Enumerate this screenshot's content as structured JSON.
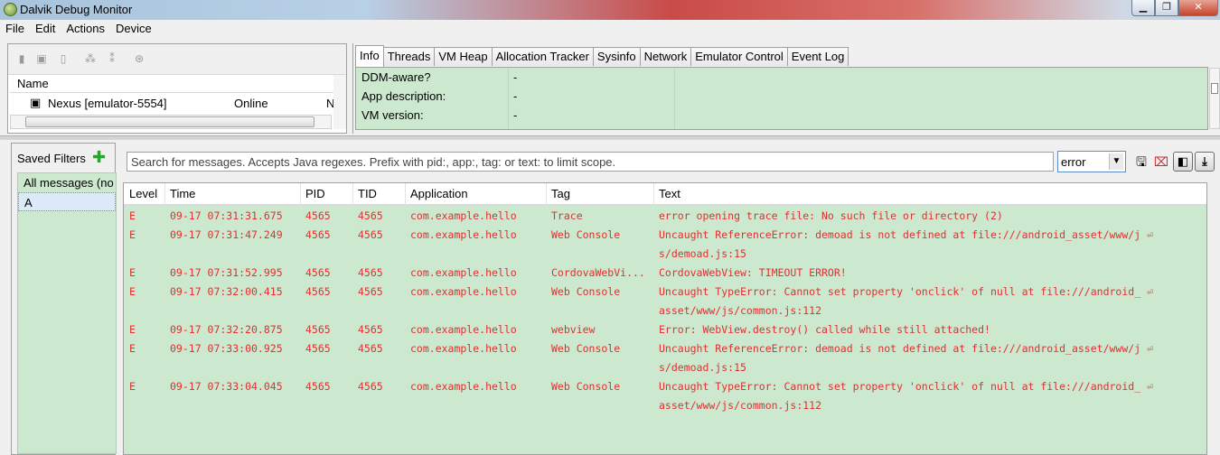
{
  "window": {
    "title": "Dalvik Debug Monitor",
    "buttons": [
      "▁",
      "❐",
      "✕"
    ]
  },
  "menu": [
    "File",
    "Edit",
    "Actions",
    "Device"
  ],
  "devices": {
    "toolbar_icons": [
      "debug-icon",
      "update-heap-icon",
      "dump-hprof-icon",
      "gc-icon",
      "update-threads-icon",
      "method-profiling-icon",
      "stop-process-icon"
    ],
    "columns": [
      "Name",
      ""
    ],
    "row": {
      "name": "Nexus [emulator-5554]",
      "status": "Online",
      "extra": "N"
    }
  },
  "tabs": [
    "Info",
    "Threads",
    "VM Heap",
    "Allocation Tracker",
    "Sysinfo",
    "Network",
    "Emulator Control",
    "Event Log"
  ],
  "info": [
    {
      "key": "DDM-aware?",
      "value": "-"
    },
    {
      "key": "App description:",
      "value": "-"
    },
    {
      "key": "VM version:",
      "value": "-"
    }
  ],
  "saved_filters": {
    "label": "Saved Filters",
    "add_symbol": "✚",
    "items": [
      "All messages (no",
      "A"
    ]
  },
  "logcat": {
    "search_placeholder": "Search for messages. Accepts Java regexes. Prefix with pid:, app:, tag: or text: to limit scope.",
    "level": "error",
    "columns": [
      "Level",
      "Time",
      "PID",
      "TID",
      "Application",
      "Tag",
      "Text"
    ],
    "rows": [
      {
        "level": "E",
        "time": "09-17 07:31:31.675",
        "pid": "4565",
        "tid": "4565",
        "app": "com.example.hello",
        "tag": "Trace",
        "text": "error opening trace file: No such file or directory (2)",
        "text2": ""
      },
      {
        "level": "E",
        "time": "09-17 07:31:47.249",
        "pid": "4565",
        "tid": "4565",
        "app": "com.example.hello",
        "tag": "Web Console",
        "text": "Uncaught ReferenceError: demoad is not defined at file:///android_asset/www/j ⏎",
        "text2": "s/demoad.js:15"
      },
      {
        "level": "E",
        "time": "09-17 07:31:52.995",
        "pid": "4565",
        "tid": "4565",
        "app": "com.example.hello",
        "tag": "CordovaWebVi...",
        "text": "CordovaWebView: TIMEOUT ERROR!",
        "text2": ""
      },
      {
        "level": "E",
        "time": "09-17 07:32:00.415",
        "pid": "4565",
        "tid": "4565",
        "app": "com.example.hello",
        "tag": "Web Console",
        "text": "Uncaught TypeError: Cannot set property 'onclick' of null at file:///android_ ⏎",
        "text2": "asset/www/js/common.js:112"
      },
      {
        "level": "E",
        "time": "09-17 07:32:20.875",
        "pid": "4565",
        "tid": "4565",
        "app": "com.example.hello",
        "tag": "webview",
        "text": "Error: WebView.destroy() called while still attached!",
        "text2": ""
      },
      {
        "level": "E",
        "time": "09-17 07:33:00.925",
        "pid": "4565",
        "tid": "4565",
        "app": "com.example.hello",
        "tag": "Web Console",
        "text": "Uncaught ReferenceError: demoad is not defined at file:///android_asset/www/j ⏎",
        "text2": "s/demoad.js:15"
      },
      {
        "level": "E",
        "time": "09-17 07:33:04.045",
        "pid": "4565",
        "tid": "4565",
        "app": "com.example.hello",
        "tag": "Web Console",
        "text": "Uncaught TypeError: Cannot set property 'onclick' of null at file:///android_ ⏎",
        "text2": "asset/www/js/common.js:112"
      }
    ]
  }
}
